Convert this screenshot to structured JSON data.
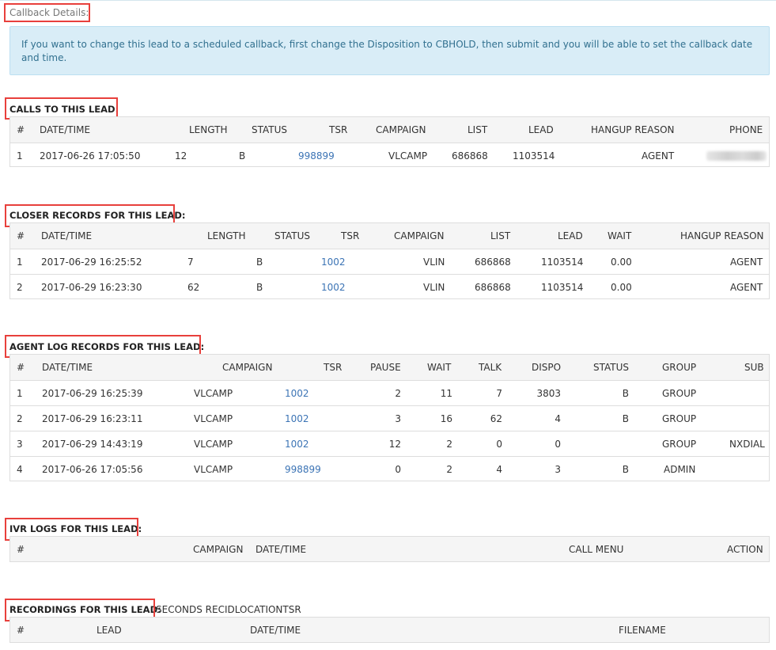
{
  "callback": {
    "label": "Callback Details:",
    "alert": "If you want to change this lead to a scheduled callback, first change the Disposition to CBHOLD, then submit and you will be able to set the callback date and time."
  },
  "calls": {
    "heading": "CALLS TO THIS LEAD:",
    "columns": [
      "#",
      "DATE/TIME",
      "LENGTH",
      "STATUS",
      "TSR",
      "CAMPAIGN",
      "LIST",
      "LEAD",
      "HANGUP REASON",
      "PHONE"
    ],
    "rows": [
      [
        "1",
        "2017-06-26 17:05:50",
        "12",
        "B",
        "998899",
        "VLCAMP",
        "686868",
        "1103514",
        "AGENT",
        ""
      ]
    ]
  },
  "closer": {
    "heading": "CLOSER RECORDS FOR THIS LEAD:",
    "columns": [
      "#",
      "DATE/TIME",
      "LENGTH",
      "STATUS",
      "TSR",
      "CAMPAIGN",
      "LIST",
      "LEAD",
      "WAIT",
      "HANGUP REASON"
    ],
    "rows": [
      [
        "1",
        "2017-06-29 16:25:52",
        "7",
        "B",
        "1002",
        "VLIN",
        "686868",
        "1103514",
        "0.00",
        "AGENT"
      ],
      [
        "2",
        "2017-06-29 16:23:30",
        "62",
        "B",
        "1002",
        "VLIN",
        "686868",
        "1103514",
        "0.00",
        "AGENT"
      ]
    ]
  },
  "agentlog": {
    "heading": "AGENT LOG RECORDS FOR THIS LEAD:",
    "columns": [
      "#",
      "DATE/TIME",
      "CAMPAIGN",
      "TSR",
      "PAUSE",
      "WAIT",
      "TALK",
      "DISPO",
      "STATUS",
      "GROUP",
      "SUB"
    ],
    "rows": [
      [
        "1",
        "2017-06-29 16:25:39",
        "VLCAMP",
        "1002",
        "2",
        "11",
        "7",
        "3803",
        "B",
        "GROUP",
        ""
      ],
      [
        "2",
        "2017-06-29 16:23:11",
        "VLCAMP",
        "1002",
        "3",
        "16",
        "62",
        "4",
        "B",
        "GROUP",
        ""
      ],
      [
        "3",
        "2017-06-29 14:43:19",
        "VLCAMP",
        "1002",
        "12",
        "2",
        "0",
        "0",
        "",
        "GROUP",
        "NXDIAL"
      ],
      [
        "4",
        "2017-06-26 17:05:56",
        "VLCAMP",
        "998899",
        "0",
        "2",
        "4",
        "3",
        "B",
        "ADMIN",
        ""
      ]
    ]
  },
  "ivr": {
    "heading": "IVR LOGS FOR THIS LEAD:",
    "columns": [
      "#",
      "CAMPAIGN",
      "DATE/TIME",
      "CALL MENU",
      "ACTION"
    ]
  },
  "recordings": {
    "heading": "RECORDINGS FOR THIS LEAD:",
    "trailing_text": "SECONDS RECIDLOCATIONTSR",
    "columns": [
      "#",
      "LEAD",
      "DATE/TIME",
      "FILENAME"
    ]
  },
  "colors": {
    "highlight": "#e8403c",
    "link": "#3c74b5",
    "alert_bg": "#d9edf7",
    "alert_text": "#31708f"
  }
}
